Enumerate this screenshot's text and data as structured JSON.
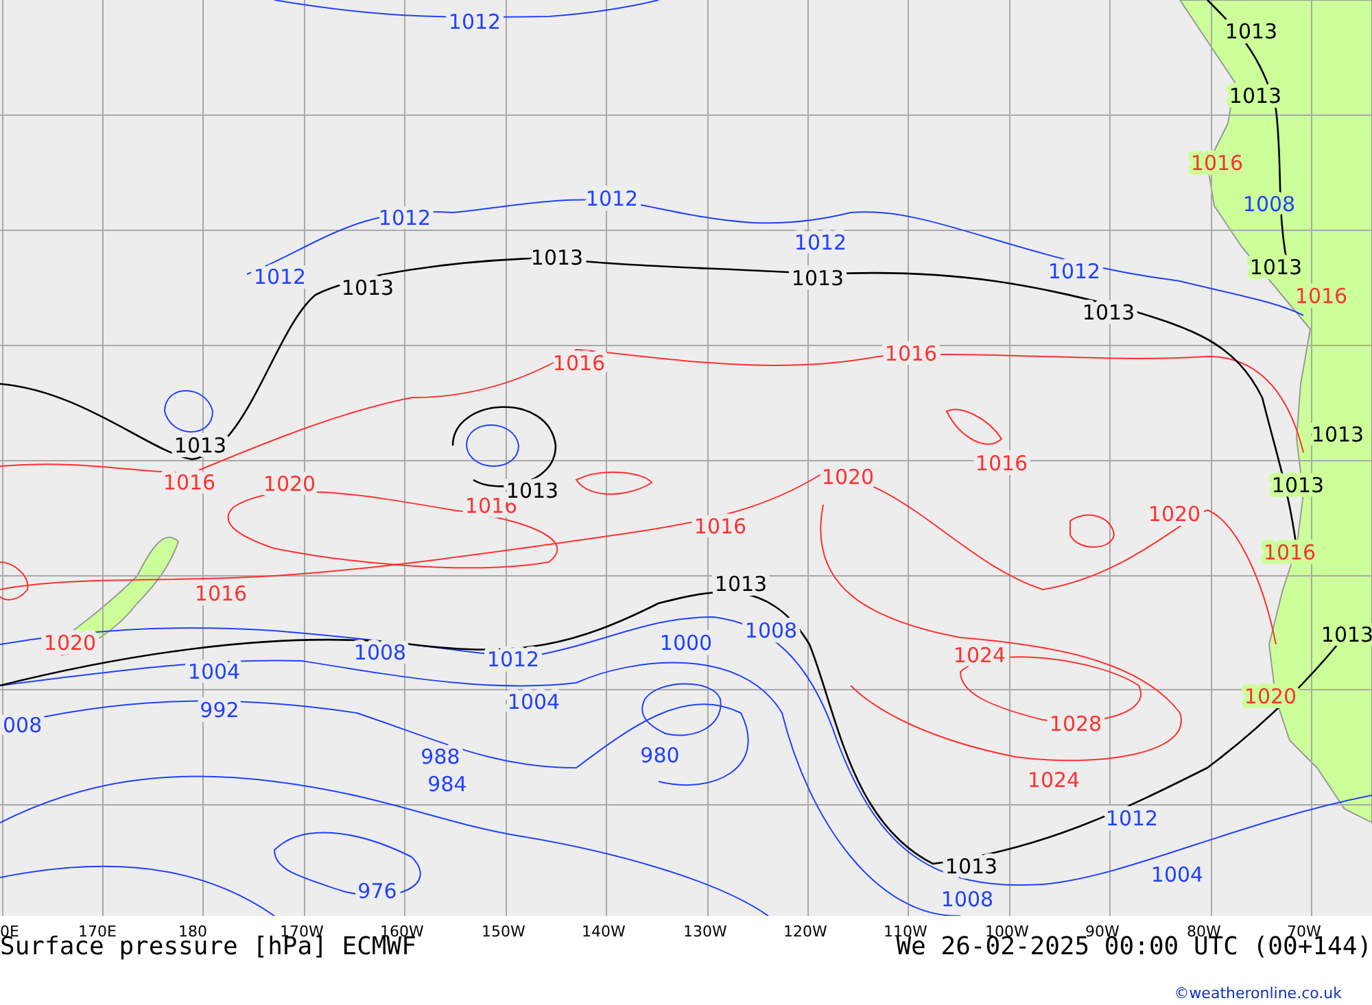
{
  "map": {
    "isobar_labels": [
      {
        "text": "1012",
        "kind": "low"
      },
      {
        "text": "1013",
        "kind": "mid"
      },
      {
        "text": "1013",
        "kind": "mid"
      },
      {
        "text": "1012",
        "kind": "low"
      },
      {
        "text": "1012",
        "kind": "low"
      },
      {
        "text": "1012",
        "kind": "low"
      },
      {
        "text": "1012",
        "kind": "low"
      },
      {
        "text": "1012",
        "kind": "low"
      },
      {
        "text": "1013",
        "kind": "mid"
      },
      {
        "text": "1013",
        "kind": "mid"
      },
      {
        "text": "1013",
        "kind": "mid"
      },
      {
        "text": "1013",
        "kind": "mid"
      },
      {
        "text": "1016",
        "kind": "high"
      },
      {
        "text": "1016",
        "kind": "high"
      },
      {
        "text": "1016",
        "kind": "high"
      },
      {
        "text": "1016",
        "kind": "high"
      },
      {
        "text": "1016",
        "kind": "high"
      },
      {
        "text": "1016",
        "kind": "high"
      },
      {
        "text": "1016",
        "kind": "high"
      },
      {
        "text": "1016",
        "kind": "high"
      },
      {
        "text": "1020",
        "kind": "high"
      },
      {
        "text": "1020",
        "kind": "high"
      },
      {
        "text": "1020",
        "kind": "high"
      },
      {
        "text": "1020",
        "kind": "high"
      },
      {
        "text": "1020",
        "kind": "high"
      },
      {
        "text": "1013",
        "kind": "mid"
      },
      {
        "text": "1013",
        "kind": "mid"
      },
      {
        "text": "1013",
        "kind": "mid"
      },
      {
        "text": "1013",
        "kind": "mid"
      },
      {
        "text": "1013",
        "kind": "mid"
      },
      {
        "text": "1013",
        "kind": "mid"
      },
      {
        "text": "1013",
        "kind": "mid"
      },
      {
        "text": "1013",
        "kind": "mid"
      },
      {
        "text": "1008",
        "kind": "low"
      },
      {
        "text": "1008",
        "kind": "low"
      },
      {
        "text": "1008",
        "kind": "low"
      },
      {
        "text": "1008",
        "kind": "low"
      },
      {
        "text": "1000",
        "kind": "low"
      },
      {
        "text": "1004",
        "kind": "low"
      },
      {
        "text": "1004",
        "kind": "low"
      },
      {
        "text": "1004",
        "kind": "low"
      },
      {
        "text": "1012",
        "kind": "low"
      },
      {
        "text": "1012",
        "kind": "low"
      },
      {
        "text": "992",
        "kind": "low"
      },
      {
        "text": "988",
        "kind": "low"
      },
      {
        "text": "984",
        "kind": "low"
      },
      {
        "text": "976",
        "kind": "low"
      },
      {
        "text": "980",
        "kind": "low"
      },
      {
        "text": "1024",
        "kind": "high"
      },
      {
        "text": "1024",
        "kind": "high"
      },
      {
        "text": "1028",
        "kind": "high"
      },
      {
        "text": "008",
        "kind": "low"
      },
      {
        "text": "1016",
        "kind": "high"
      },
      {
        "text": "1016",
        "kind": "high"
      }
    ]
  },
  "axis_labels": [
    "0E",
    "170E",
    "180",
    "170W",
    "160W",
    "150W",
    "140W",
    "130W",
    "120W",
    "110W",
    "100W",
    "90W",
    "80W",
    "70W"
  ],
  "title": "Surface pressure [hPa] ECMWF",
  "valid_time": "We 26-02-2025 00:00 UTC (00+144)",
  "credit": "©weatheronline.co.uk"
}
